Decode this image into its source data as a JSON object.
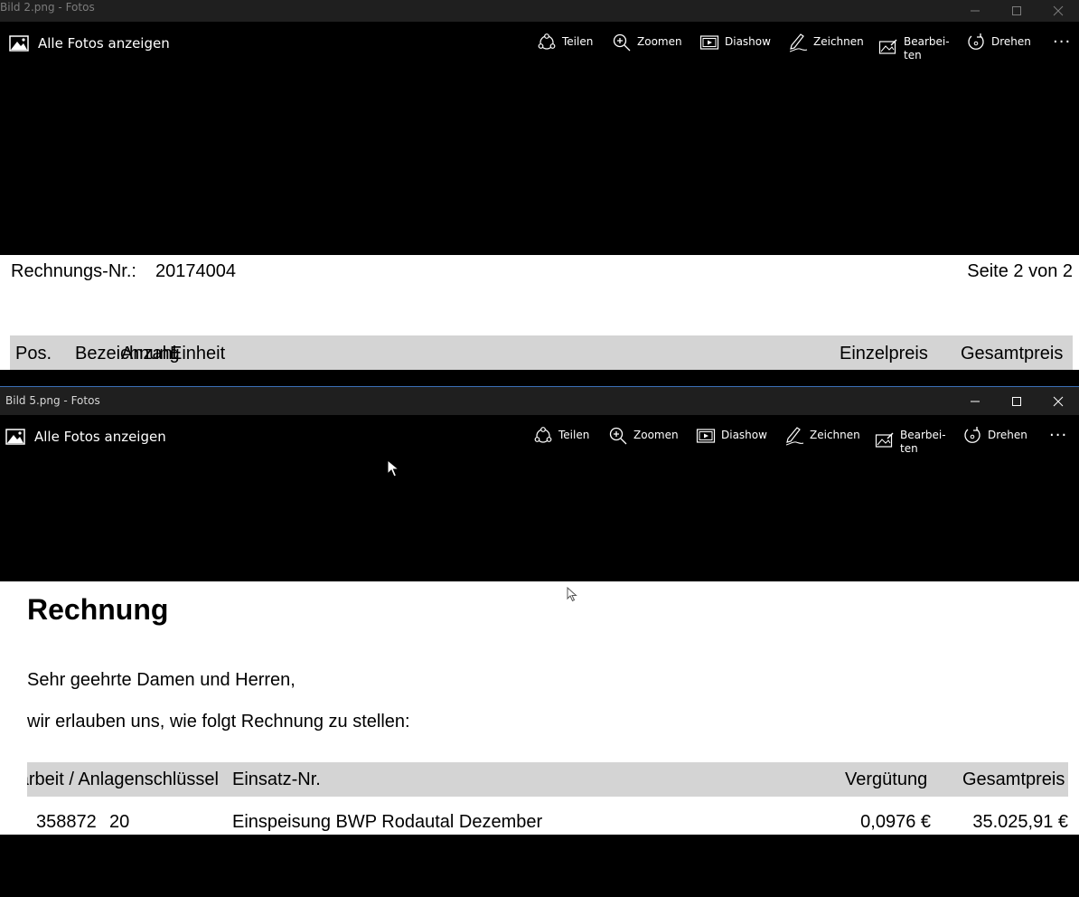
{
  "window1": {
    "title": "Bild 2.png - Fotos",
    "show_all": "Alle Fotos anzeigen",
    "toolbar": {
      "share": "Teilen",
      "zoom": "Zoomen",
      "slideshow": "Diashow",
      "draw": "Zeichnen",
      "edit_1": "Bearbei-",
      "edit_2": "ten",
      "rotate": "Drehen",
      "more": "···"
    },
    "doc": {
      "invoice_label": "Rechnungs-Nr.:",
      "invoice_number": "20174004",
      "page": "Seite 2 von 2",
      "headers": [
        "Pos.",
        "Bezeichnung",
        "Anzahl",
        "Einheit",
        "Einzelpreis",
        "Gesamtpreis"
      ]
    }
  },
  "window2": {
    "title": "Bild 5.png - Fotos",
    "show_all": "Alle Fotos anzeigen",
    "toolbar": {
      "share": "Teilen",
      "zoom": "Zoomen",
      "slideshow": "Diashow",
      "draw": "Zeichnen",
      "edit_1": "Bearbei-",
      "edit_2": "ten",
      "rotate": "Drehen",
      "more": "···"
    },
    "doc": {
      "heading": "Rechnung",
      "greeting": "Sehr geehrte Damen und Herren,",
      "intro": "wir erlauben uns, wie folgt Rechnung zu stellen:",
      "headers": [
        "Fallarbeit / Anlagenschlüssel",
        "Einsatz-Nr.",
        "Vergütung",
        "Gesamtpreis"
      ],
      "row": [
        "358872",
        "20",
        "Einspeisung BWP Rodautal Dezember",
        "0,0976 €",
        "35.025,91 €"
      ]
    }
  },
  "colors": {
    "titlebar": "#1f1f1f",
    "toolbar": "#000000",
    "table_header": "#d4d4d4",
    "active_border": "#3b6fb6"
  }
}
